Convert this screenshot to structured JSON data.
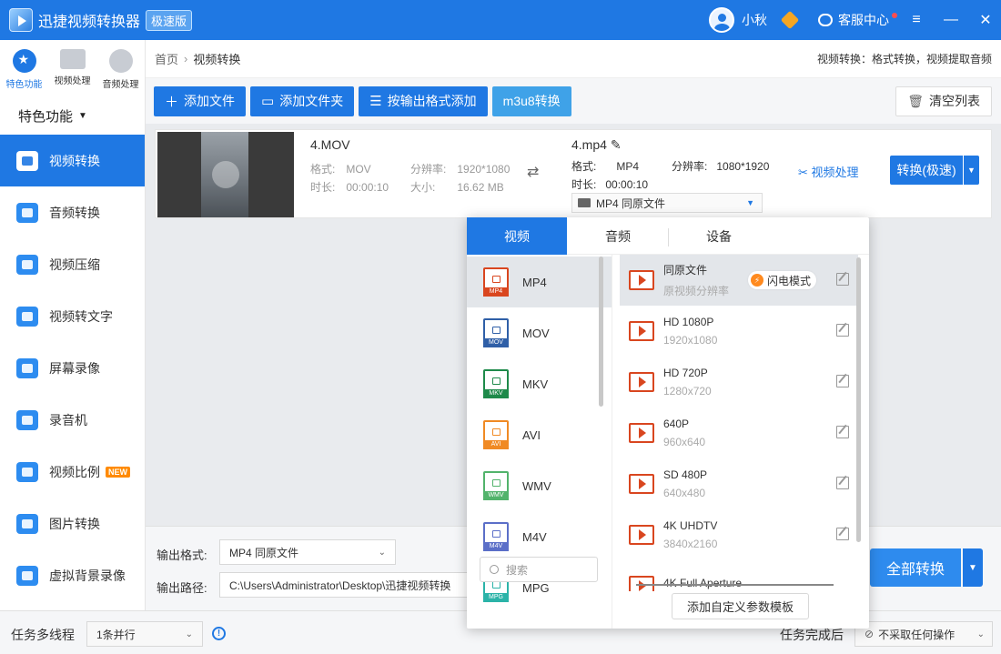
{
  "titlebar": {
    "title": "迅捷视频转换器",
    "edition": "极速版",
    "username": "小秋",
    "service": "客服中心",
    "minimize": "—",
    "close": "✕"
  },
  "sidebar": {
    "tabs": [
      {
        "label": "特色功能"
      },
      {
        "label": "视频处理"
      },
      {
        "label": "音频处理"
      }
    ],
    "section_title": "特色功能",
    "items": [
      {
        "label": "视频转换"
      },
      {
        "label": "音频转换"
      },
      {
        "label": "视频压缩"
      },
      {
        "label": "视频转文字"
      },
      {
        "label": "屏幕录像"
      },
      {
        "label": "录音机"
      },
      {
        "label": "视频比例",
        "badge": "NEW"
      },
      {
        "label": "图片转换"
      },
      {
        "label": "虚拟背景录像"
      }
    ]
  },
  "breadcrumb": {
    "home": "首页",
    "current": "视频转换",
    "hint": "视频转换：格式转换，视频提取音频"
  },
  "toolbar": {
    "add_file": "添加文件",
    "add_folder": "添加文件夹",
    "add_by_format": "按输出格式添加",
    "m3u8": "m3u8转换",
    "clear_list": "清空列表"
  },
  "file": {
    "name": "4.MOV",
    "format_label": "格式:",
    "format": "MOV",
    "resolution_label": "分辨率:",
    "resolution": "1920*1080",
    "duration_label": "时长:",
    "duration": "00:00:10",
    "size_label": "大小:",
    "size": "16.62 MB",
    "out_name": "4.mp4",
    "out_format": "MP4",
    "out_resolution": "1080*1920",
    "out_duration": "00:00:10",
    "out_select": "MP4   同原文件",
    "video_process": "视频处理",
    "convert_btn": "转换(极速)"
  },
  "output": {
    "format_label": "输出格式:",
    "format_value": "MP4   同原文件",
    "path_label": "输出路径:",
    "path_value": "C:\\Users\\Administrator\\Desktop\\迅捷视频转换",
    "convert_all": "全部转换"
  },
  "statusbar": {
    "multi_label": "任务多线程",
    "multi_value": "1条并行",
    "after_label": "任务完成后",
    "after_value": "不采取任何操作"
  },
  "popup": {
    "tabs": [
      "视频",
      "音频",
      "设备"
    ],
    "formats": [
      {
        "name": "MP4",
        "color": "#d9461f"
      },
      {
        "name": "MOV",
        "color": "#2f5fa7"
      },
      {
        "name": "MKV",
        "color": "#1e8a4a"
      },
      {
        "name": "AVI",
        "color": "#f08a24"
      },
      {
        "name": "WMV",
        "color": "#52b36b"
      },
      {
        "name": "M4V",
        "color": "#5b6fc8"
      },
      {
        "name": "MPG",
        "color": "#2bb3a8"
      }
    ],
    "qualities": [
      {
        "name": "同原文件",
        "sub": "原视频分辨率"
      },
      {
        "name": "HD 1080P",
        "sub": "1920x1080"
      },
      {
        "name": "HD 720P",
        "sub": "1280x720"
      },
      {
        "name": "640P",
        "sub": "960x640"
      },
      {
        "name": "SD 480P",
        "sub": "640x480"
      },
      {
        "name": "4K UHDTV",
        "sub": "3840x2160"
      },
      {
        "name": "4K Full Aperture",
        "sub": ""
      }
    ],
    "flash_mode": "闪电模式",
    "search_placeholder": "搜索",
    "add_template": "添加自定义参数模板"
  }
}
